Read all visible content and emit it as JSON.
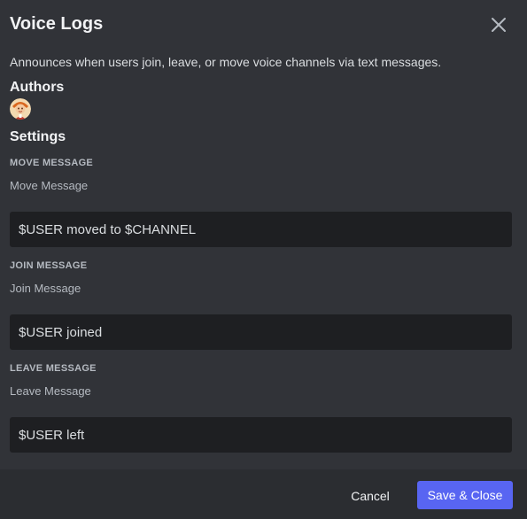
{
  "modal": {
    "title": "Voice Logs",
    "description": "Announces when users join, leave, or move voice channels via text messages."
  },
  "authors": {
    "heading": "Authors"
  },
  "settings": {
    "heading": "Settings",
    "fields": [
      {
        "label": "MOVE MESSAGE",
        "note": "Move Message",
        "value": "$USER moved to $CHANNEL"
      },
      {
        "label": "JOIN MESSAGE",
        "note": "Join Message",
        "value": "$USER joined"
      },
      {
        "label": "LEAVE MESSAGE",
        "note": "Leave Message",
        "value": "$USER left"
      }
    ]
  },
  "footer": {
    "cancel_label": "Cancel",
    "save_label": "Save & Close"
  },
  "icons": {
    "close": "close-icon",
    "avatar": "author-avatar"
  },
  "colors": {
    "background": "#313338",
    "footer": "#2b2d31",
    "input": "#1e1f22",
    "accent": "#5865f2"
  }
}
